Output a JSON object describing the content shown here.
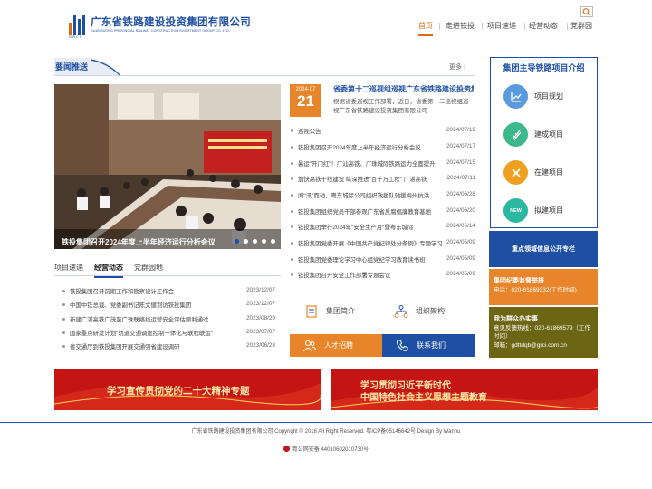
{
  "header": {
    "logo_cn": "广东省铁路建设投资集团有限公司",
    "logo_en": "GUANGDONG PROVINCIAL RAILWAY CONSTRUCTION INVESTMENT GROUP CO.,LTD.",
    "logo_sub": "GRCI",
    "nav": [
      "首页",
      "走进铁投",
      "项目速递",
      "经营动态",
      "党群园"
    ]
  },
  "news": {
    "section_title": "要闻推送",
    "more": "更多",
    "carousel_caption": "铁投集团召开2024年度上半年经济运行分析会议",
    "featured": {
      "month": "2024-07",
      "day": "21",
      "title": "省委第十二巡视组巡视广东省铁路建设投资集团有限公司工作动员会召开",
      "desc": "根据省委巡视工作部署，近日，省委第十二巡视组巡视广东省铁路建设投资集团有限公司"
    },
    "items": [
      {
        "title": "巡视公告",
        "date": "2024/07/19"
      },
      {
        "title": "铁投集团召开2024年度上半年经济运行分析会议",
        "date": "2024/07/17"
      },
      {
        "title": "暑运\"开门红\"！广汕高铁、广珠城际铁路运力全面提升",
        "date": "2024/07/15"
      },
      {
        "title": "加快高铁干线建设 纵深推进\"百千万工程\" 广湛高铁",
        "date": "2024/07/11"
      },
      {
        "title": "闻\"汛\"而动，粤东城际公司组织救援队驰援梅州抗洪",
        "date": "2024/06/28"
      },
      {
        "title": "铁投集团组织党员干部参观广东省反腐倡廉教育基地",
        "date": "2024/06/20"
      },
      {
        "title": "铁投集团举行2024年\"安全生产月\"暨粤东城际",
        "date": "2024/06/14"
      },
      {
        "title": "铁投集团党委开展《中国共产党纪律处分条例》专题学习",
        "date": "2024/05/09"
      },
      {
        "title": "铁投集团党委理论学习中心组党纪学习教育读书班",
        "date": "2024/05/09"
      },
      {
        "title": "铁投集团召开安全工作部署专题会议",
        "date": "2024/05/09"
      }
    ]
  },
  "tabs": {
    "labels": [
      "项目速递",
      "经营动态",
      "党群园地"
    ],
    "items": [
      {
        "title": "铁投集团召开前期工作和勘察设计工作会",
        "date": "2023/12/07"
      },
      {
        "title": "中国中铁总裁、党委副书记陈文健到访铁投集团",
        "date": "2023/12/07"
      },
      {
        "title": "新建广湛高铁广茂至广珠联络线运营安全评估顺利通过",
        "date": "2023/08/29"
      },
      {
        "title": "国家重点研发计划\"轨道交通调度控制一体化与联程联运\"",
        "date": "2023/07/07"
      },
      {
        "title": "省交通厅到铁投集团开展交通强省建设调研",
        "date": "2023/06/28"
      }
    ]
  },
  "links": {
    "intro": "集团简介",
    "org": "组织架构",
    "recruit": "人才招聘",
    "contact": "联系我们"
  },
  "projects": {
    "title": "集团主导铁路项目介绍",
    "items": [
      {
        "label": "项目规划",
        "color": "#5a9be0"
      },
      {
        "label": "建成项目",
        "color": "#3cb88a"
      },
      {
        "label": "在建项目",
        "color": "#f0a020"
      },
      {
        "label": "拟建项目",
        "color": "#2ab8a0"
      }
    ],
    "new_badge": "NEW"
  },
  "right": {
    "disclosure": "重点领域信息公开专栏",
    "supervise_title": "集团纪委监督举报",
    "supervise_phone": "电话：020-61869332(工作时间)",
    "service_title": "我为群众办实事",
    "service_phone": "意见反馈热线：020-61869579（工作时间）",
    "service_email": "邮箱：gdttdqb@grci.com.cn"
  },
  "banners": {
    "left": "学习宣传贯彻党的二十大精神专题",
    "right_1": "学习贯彻习近平新时代",
    "right_2": "中国特色社会主义思想主题教育"
  },
  "footer": {
    "copyright": "广东省铁路建设投资集团有限公司 Copyright © 2016 All Right Reserved.   粤ICP备05146642号    Design By Wanhu",
    "police": "粤公网安备 44010602010730号"
  },
  "colors": {
    "brand": "#1e4fa3",
    "accent": "#e26a12",
    "orange": "#e8852a",
    "olive": "#6b6514",
    "banner_red": "#c41414"
  }
}
